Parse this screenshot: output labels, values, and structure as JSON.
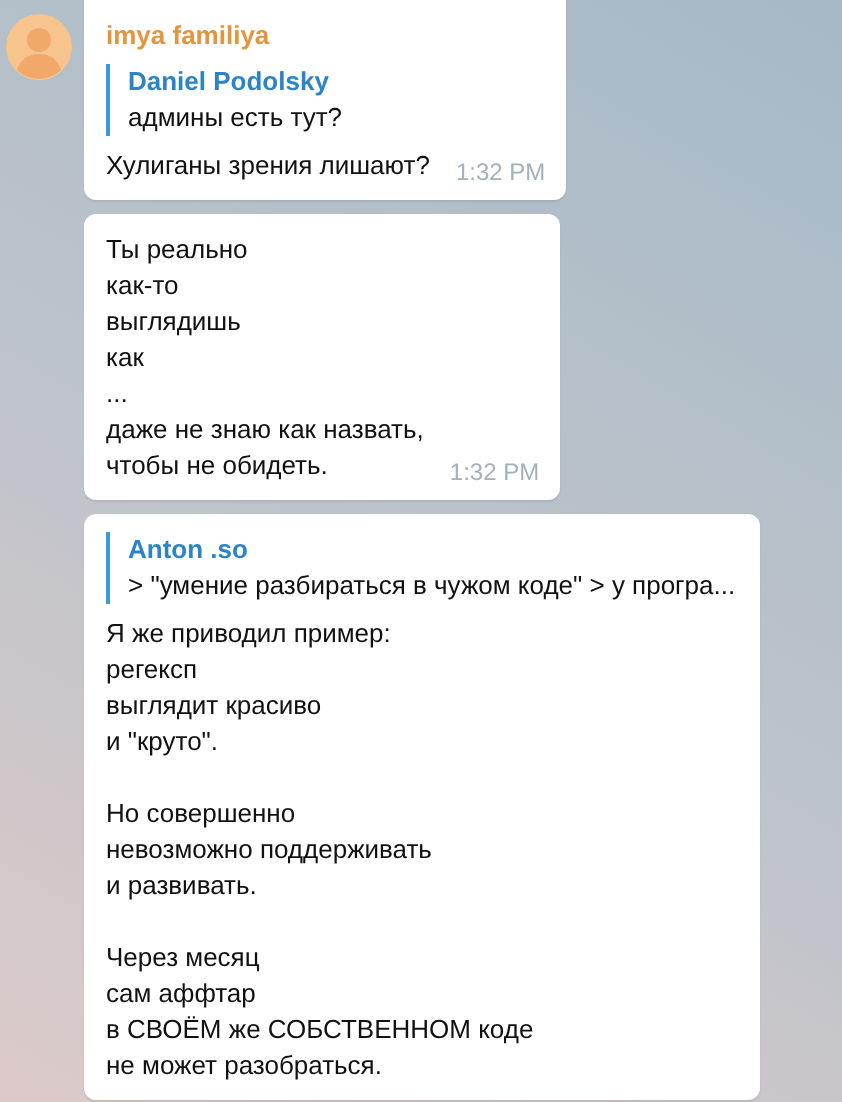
{
  "messages": [
    {
      "sender": "imya familiya",
      "reply": {
        "author": "Daniel Podolsky",
        "text": "админы есть тут?"
      },
      "text": "Хулиганы зрения лишают?",
      "time": "1:32 PM"
    },
    {
      "text": "Ты реально\nкак-то\nвыглядишь\nкак\n...\nдаже не знаю как назвать,\nчтобы не обидеть.",
      "time": "1:32 PM"
    },
    {
      "reply": {
        "author": "Anton .so",
        "text": "> \"умение разбираться в чужом коде\" > у програ..."
      },
      "text": "Я же приводил пример:\nрегексп\nвыглядит красиво\nи \"круто\".\n\nНо совершенно\nневозможно поддерживать\nи развивать.\n\nЧерез месяц\nсам аффтар\nв СВОЁМ же СОБСТВЕННОМ коде\nне может разобраться."
    }
  ]
}
